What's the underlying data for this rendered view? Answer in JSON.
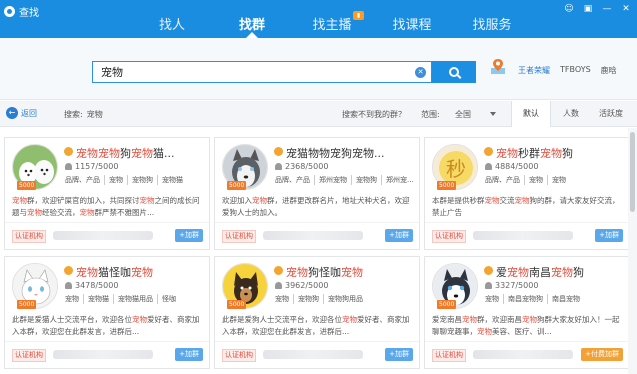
{
  "app": {
    "title": "查找"
  },
  "window_controls": [
    "☺",
    "▣",
    "—",
    "✕"
  ],
  "nav": {
    "tabs": [
      {
        "label": "找人",
        "active": false
      },
      {
        "label": "找群",
        "active": true
      },
      {
        "label": "找主播",
        "active": false,
        "badge": "live"
      },
      {
        "label": "找课程",
        "active": false
      },
      {
        "label": "找服务",
        "active": false
      }
    ]
  },
  "search": {
    "value": "宠物",
    "placeholder": ""
  },
  "location": {
    "cities": [
      "王者荣耀",
      "TFBOYS",
      "鹿晗"
    ]
  },
  "filter": {
    "back_label": "返回",
    "search_prefix": "搜索:",
    "search_term": "宠物",
    "not_found": "搜索不到我的群？",
    "range_label": "范围:",
    "range_value": "全国",
    "sort_tabs": [
      "默认",
      "人数",
      "活跃度"
    ],
    "active_sort": "默认"
  },
  "groups": [
    {
      "name_parts": [
        [
          "宠物",
          true
        ],
        [
          "宠物",
          true
        ],
        [
          "狗",
          false
        ],
        [
          "宠物",
          true
        ],
        [
          "猫...",
          false
        ]
      ],
      "members": "1157/5000",
      "tags": [
        "品牌、产品",
        "宠物",
        "宠物狗",
        "宠物猫"
      ],
      "desc_parts": [
        [
          "宠物",
          true
        ],
        [
          "群，欢迎铲屎官的加入，共同探讨",
          false
        ],
        [
          "宠物",
          true
        ],
        [
          "之间的成长问题与",
          false
        ],
        [
          "宠物",
          true
        ],
        [
          "经验交流，",
          false
        ],
        [
          "宠物",
          true
        ],
        [
          "群严禁不雅图片...",
          false
        ]
      ],
      "capacity": "5000",
      "cert": "认证机构",
      "join": "+加群",
      "paid": false,
      "avatar": "dogs"
    },
    {
      "name_parts": [
        [
          "宠猫物物宠狗宠物...",
          false
        ]
      ],
      "members": "2368/5000",
      "tags": [
        "品牌、产品",
        "郑州宠物",
        "宠物狗",
        "郑州宠..."
      ],
      "desc_parts": [
        [
          "欢迎加入",
          false
        ],
        [
          "宠物",
          true
        ],
        [
          "群，进群更改群名片，地址犬种犬名，欢迎爱狗人士的加入。",
          false
        ]
      ],
      "capacity": "5000",
      "cert": "认证机构",
      "join": "+加群",
      "paid": false,
      "avatar": "husky"
    },
    {
      "name_parts": [
        [
          "宠物",
          true
        ],
        [
          "秒群",
          false
        ],
        [
          "宠物",
          true
        ],
        [
          "狗",
          false
        ]
      ],
      "members": "4884/5000",
      "tags": [
        "品牌、产品",
        "宠物",
        "宠物"
      ],
      "desc_parts": [
        [
          "本群是提供秒群",
          false
        ],
        [
          "宠物",
          true
        ],
        [
          "交流",
          false
        ],
        [
          "宠物",
          true
        ],
        [
          "狗的群，请大家友好交流，禁止广告",
          false
        ]
      ],
      "capacity": "5000",
      "cert": "认证机构",
      "join": "+加群",
      "paid": false,
      "avatar": "miao"
    },
    {
      "name_parts": [
        [
          "宠物",
          true
        ],
        [
          "猫怪咖",
          false
        ],
        [
          "宠物",
          true
        ]
      ],
      "members": "3478/5000",
      "tags": [
        "宠物",
        "宠物猫",
        "宠物猫用品",
        "怪咖"
      ],
      "desc_parts": [
        [
          "此群是爱猫人士交流平台，欢迎各位",
          false
        ],
        [
          "宠物",
          true
        ],
        [
          "爱好者、商家加入本群，欢迎您在此群发言，进群后...",
          false
        ]
      ],
      "capacity": "5000",
      "cert": "认证机构",
      "join": "+加群",
      "paid": false,
      "avatar": "cat"
    },
    {
      "name_parts": [
        [
          "宠物",
          true
        ],
        [
          "狗怪咖",
          false
        ],
        [
          "宠物",
          true
        ]
      ],
      "members": "3962/5000",
      "tags": [
        "宠物",
        "宠物狗",
        "宠物狗用品"
      ],
      "desc_parts": [
        [
          "此群是爱狗人士交流平台，欢迎各位",
          false
        ],
        [
          "宠物",
          true
        ],
        [
          "爱好者、商家加入本群，欢迎您在此群发言，进群后...",
          false
        ]
      ],
      "capacity": "5000",
      "cert": "认证机构",
      "join": "+加群",
      "paid": false,
      "avatar": "dog2"
    },
    {
      "name_parts": [
        [
          "爱",
          false
        ],
        [
          "宠物",
          true
        ],
        [
          "南昌",
          false
        ],
        [
          "宠物",
          true
        ],
        [
          "狗",
          false
        ]
      ],
      "members": "3327/5000",
      "tags": [
        "宠物",
        "南昌宠物狗",
        "南昌宠物"
      ],
      "desc_parts": [
        [
          "爱宠南昌",
          false
        ],
        [
          "宠物",
          true
        ],
        [
          "群，欢迎南昌",
          false
        ],
        [
          "宠物",
          true
        ],
        [
          "狗群大家友好加入！一起聊聊宠趣事，",
          false
        ],
        [
          "宠物",
          true
        ],
        [
          "美容、医疗、训...",
          false
        ]
      ],
      "capacity": "5000",
      "cert": "认证机构",
      "join": "+付费加群",
      "paid": true,
      "avatar": "husky2"
    }
  ]
}
